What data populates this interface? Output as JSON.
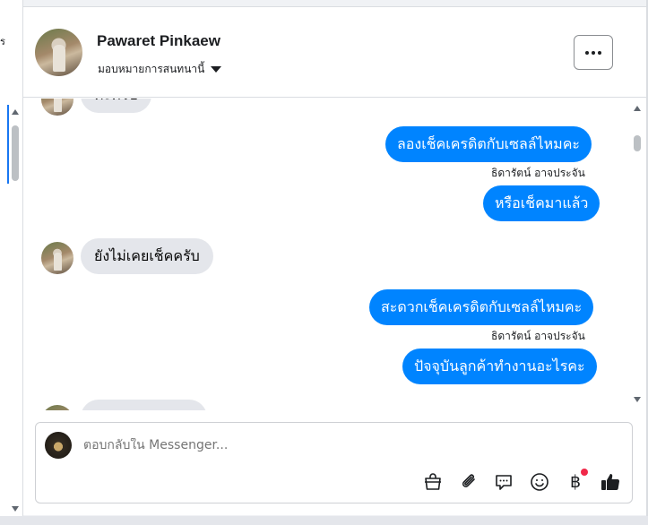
{
  "left_strip": {
    "glyph": "ร"
  },
  "header": {
    "name": "Pawaret Pinkaew",
    "assign_label": "มอบหมายการสนทนานี้"
  },
  "messages": [
    {
      "side": "in",
      "text": "ค่ะครับ",
      "partial": true
    },
    {
      "side": "out",
      "text": "ลองเช็คเครดิตกับเซลล์ไหมคะ"
    },
    {
      "side": "label",
      "text": "ธิดารัตน์ อาจประจัน"
    },
    {
      "side": "out",
      "text": "หรือเช็คมาแล้ว"
    },
    {
      "side": "in",
      "text": "ยังไม่เคยเช็คครับ"
    },
    {
      "side": "out",
      "text": "สะดวกเช็คเครดิตกับเซลล์ไหมคะ"
    },
    {
      "side": "label",
      "text": "ธิดารัตน์ อาจประจัน"
    },
    {
      "side": "out",
      "text": "ปัจจุบันลูกค้าทำงานอะไรคะ"
    }
  ],
  "composer": {
    "placeholder": "ตอบกลับใน Messenger...",
    "tools": [
      "shopping-bag-icon",
      "paperclip-icon",
      "speech-bubble-icon",
      "smiley-icon",
      "baht-icon",
      "thumbs-up-icon"
    ],
    "baht_symbol": "฿"
  },
  "colors": {
    "outgoing_bubble": "#0084ff",
    "incoming_bubble": "#e4e6eb",
    "notification_dot": "#f02849"
  }
}
